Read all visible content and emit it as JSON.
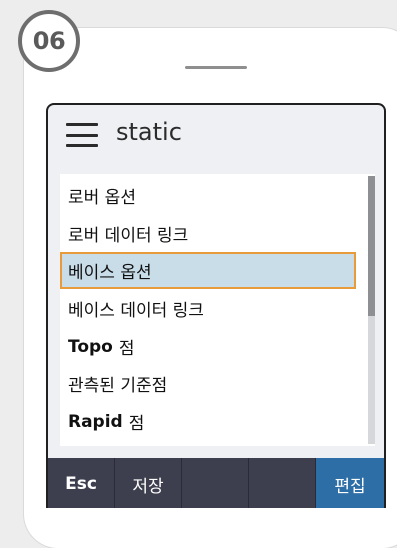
{
  "step_number": "06",
  "header": {
    "title": "static"
  },
  "list": {
    "items": [
      {
        "bold": "",
        "text": "로버 옵션",
        "selected": false
      },
      {
        "bold": "",
        "text": "로버 데이터 링크",
        "selected": false
      },
      {
        "bold": "",
        "text": "베이스 옵션",
        "selected": true
      },
      {
        "bold": "",
        "text": "베이스 데이터 링크",
        "selected": false
      },
      {
        "bold": "Topo",
        "text": "점",
        "selected": false
      },
      {
        "bold": "",
        "text": "관측된 기준점",
        "selected": false
      },
      {
        "bold": "Rapid",
        "text": "점",
        "selected": false
      }
    ]
  },
  "toolbar": {
    "esc_label": "Esc",
    "save_label": "저장",
    "empty1_label": "",
    "empty2_label": "",
    "edit_label": "편집"
  },
  "colors": {
    "selection_fill": "#c9dde9",
    "selection_border": "#e89b3a",
    "toolbar_bg": "#3d3f4f",
    "edit_button_bg": "#2e6ea6"
  }
}
